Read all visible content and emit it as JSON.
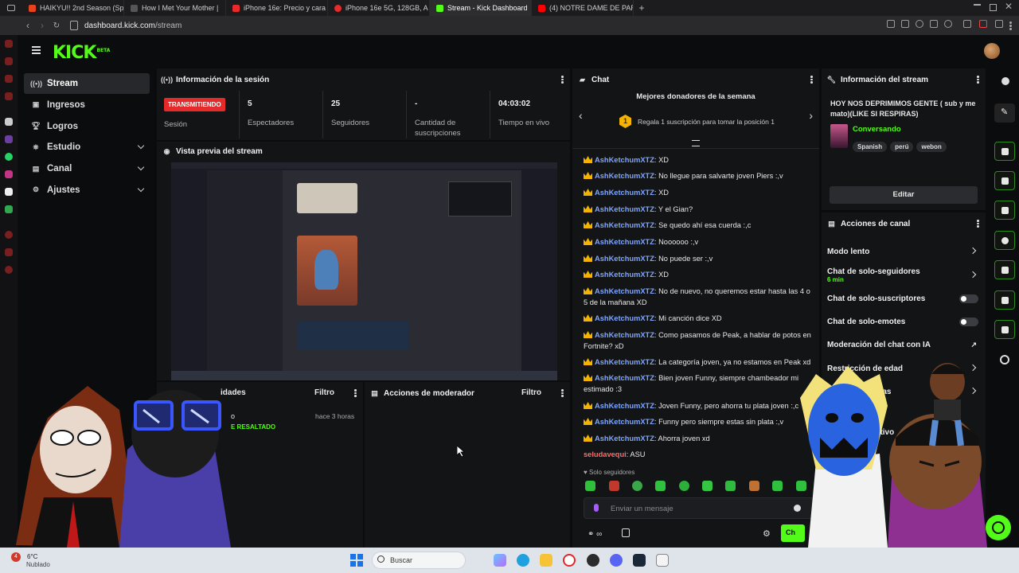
{
  "browser": {
    "tabs": [
      {
        "label": "HAIKYU!! 2nd Season (Sp",
        "color": "#e8411c"
      },
      {
        "label": "How I Met Your Mother |",
        "color": "#2a2a2a"
      },
      {
        "label": "iPhone 16e: Precio y cara",
        "color": "#e82a2a"
      },
      {
        "label": "iPhone 16e 5G, 128GB, A",
        "color": "#e82a2a"
      },
      {
        "label": "Stream - Kick Dashboard",
        "color": "#53fc18"
      },
      {
        "label": "(4) NOTRE DAME DE PAR",
        "color": "#ff0000"
      }
    ],
    "new_tab": "+",
    "url_host": "dashboard.kick.com",
    "url_path": "/stream"
  },
  "kick": {
    "logo": "KICK",
    "logo_sup": "BETA",
    "nav": [
      {
        "label": "Stream",
        "icon": "broadcast-icon"
      },
      {
        "label": "Ingresos",
        "icon": "income-icon"
      },
      {
        "label": "Logros",
        "icon": "trophy-icon"
      },
      {
        "label": "Estudio",
        "icon": "studio-icon"
      },
      {
        "label": "Canal",
        "icon": "channel-icon"
      },
      {
        "label": "Ajustes",
        "icon": "gear-icon"
      }
    ]
  },
  "session": {
    "title": "Información de la sesión",
    "status": "TRANSMITIENDO",
    "session_label": "Sesión",
    "stats": [
      {
        "value": "5",
        "label": "Espectadores"
      },
      {
        "value": "25",
        "label": "Seguidores"
      },
      {
        "value": "-",
        "label": "Cantidad de suscripciones"
      },
      {
        "value": "04:03:02",
        "label": "Tiempo en vivo"
      }
    ]
  },
  "preview": {
    "title": "Vista previa del stream"
  },
  "activity": {
    "title": "idades",
    "filter": "Filtro",
    "item_time": "hace 3 horas",
    "item_name": "o",
    "item_tag": "E RESALTADO"
  },
  "moderator": {
    "title": "Acciones de moderador",
    "filter": "Filtro"
  },
  "chat": {
    "title": "Chat",
    "donors_title": "Mejores donadores de la semana",
    "donors_rank": "1",
    "donors_text": "Regala 1 suscripción para tomar la posición 1",
    "messages": [
      {
        "user": "AshKetchumXTZ",
        "text": ": XD"
      },
      {
        "user": "AshKetchumXTZ",
        "text": ": No llegue para salvarte joven Piers :,v"
      },
      {
        "user": "AshKetchumXTZ",
        "text": ": XD"
      },
      {
        "user": "AshKetchumXTZ",
        "text": ": Y el Gian?"
      },
      {
        "user": "AshKetchumXTZ",
        "text": ": Se quedo ahí esa cuerda :,c"
      },
      {
        "user": "AshKetchumXTZ",
        "text": ": Noooooo :,v"
      },
      {
        "user": "AshKetchumXTZ",
        "text": ": No puede ser :,v"
      },
      {
        "user": "AshKetchumXTZ",
        "text": ": XD"
      },
      {
        "user": "AshKetchumXTZ",
        "text": ": No de nuevo, no queremos estar hasta las 4 o 5 de la mañana XD"
      },
      {
        "user": "AshKetchumXTZ",
        "text": ": Mi canción dice XD"
      },
      {
        "user": "AshKetchumXTZ",
        "text": ": Como pasamos de Peak, a hablar de potos en Fortnite? xD"
      },
      {
        "user": "AshKetchumXTZ",
        "text": ": La categoría joven, ya no estamos en Peak xd"
      },
      {
        "user": "AshKetchumXTZ",
        "text": ": Bien joven Funny, siempre chambeador mi estimado :3"
      },
      {
        "user": "AshKetchumXTZ",
        "text": ": Joven Funny, pero ahorra tu plata joven :,c"
      },
      {
        "user": "AshKetchumXTZ",
        "text": ": Funny pero siempre estas sin plata :,v"
      },
      {
        "user": "AshKetchumXTZ",
        "text": ": Ahorra joven xd"
      }
    ],
    "last_user": "seludavequi",
    "last_text": ": ASU",
    "followers_only": "Solo seguidores",
    "input_placeholder": "Enviar un mensaje",
    "send_label": "Ch"
  },
  "stream_info": {
    "title": "Información del stream",
    "stream_title": "HOY NOS DEPRIMIMOS GENTE ( sub y me mato)(LIKE SI RESPIRAS)",
    "category": "Conversando",
    "tags": [
      "Spanish",
      "perú",
      "webon"
    ],
    "edit_label": "Editar"
  },
  "channel_actions": {
    "title": "Acciones de canal",
    "items": [
      {
        "label": "Modo lento",
        "control": "chevron"
      },
      {
        "label": "Chat de solo-seguidores",
        "sub": "6 min",
        "control": "chevron"
      },
      {
        "label": "Chat de solo-suscriptores",
        "control": "toggle"
      },
      {
        "label": "Chat de solo-emotes",
        "control": "toggle"
      },
      {
        "label": "Moderación del chat con IA",
        "control": "external"
      },
      {
        "label": "Restricción de edad",
        "control": "chevron"
      },
      {
        "label": "neadas",
        "control": "chevron"
      },
      {
        "label": "bjetivo",
        "control": "none"
      }
    ]
  },
  "taskbar": {
    "weather_temp": "6°C",
    "weather_desc": "Nublado",
    "weather_badge": "4",
    "search_label": "Buscar"
  },
  "colors": {
    "accent": "#53fc18",
    "live": "#e42a2a",
    "chat_user": "#7ea6ff"
  }
}
